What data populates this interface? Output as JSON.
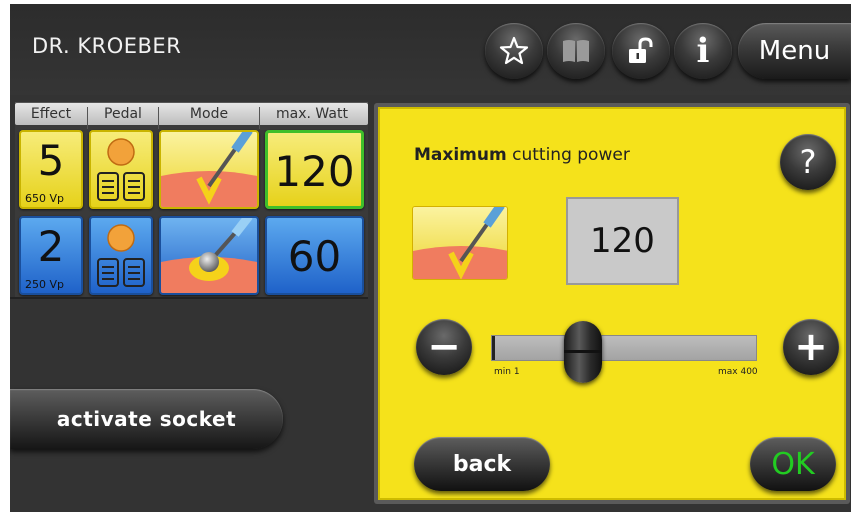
{
  "header": {
    "title": "DR. KROEBER",
    "menu_label": "Menu",
    "buttons": [
      {
        "name": "star-icon"
      },
      {
        "name": "book-icon"
      },
      {
        "name": "unlock-icon"
      },
      {
        "name": "info-icon",
        "glyph": "i"
      }
    ]
  },
  "table": {
    "columns": [
      "Effect",
      "Pedal",
      "Mode",
      "max. Watt"
    ],
    "rows": [
      {
        "effect": "5",
        "voltage": "650 Vp",
        "mode_icon": "cutting-blade-icon",
        "pedal_icon": "pedal-icon",
        "max_watt": "120",
        "color": "yellow",
        "selected": true
      },
      {
        "effect": "2",
        "voltage": "250 Vp",
        "mode_icon": "ball-electrode-icon",
        "pedal_icon": "pedal-icon",
        "max_watt": "60",
        "color": "blue",
        "selected": false
      }
    ]
  },
  "activate_label": "activate socket",
  "dialog": {
    "title_bold": "Maximum",
    "title_rest": " cutting power",
    "help_glyph": "?",
    "value": "120",
    "slider": {
      "min_label": "min 1",
      "max_label": "max 400",
      "min": 1,
      "max": 400,
      "value": 120
    },
    "minus_glyph": "−",
    "plus_glyph": "+",
    "back_label": "back",
    "ok_label": "OK"
  },
  "colors": {
    "dialog_bg": "#f5e21b",
    "ok_text": "#22cc22",
    "tile_yellow": "#efdf3a",
    "tile_blue": "#2f7fdc",
    "selected_border": "#3fbf2a"
  }
}
